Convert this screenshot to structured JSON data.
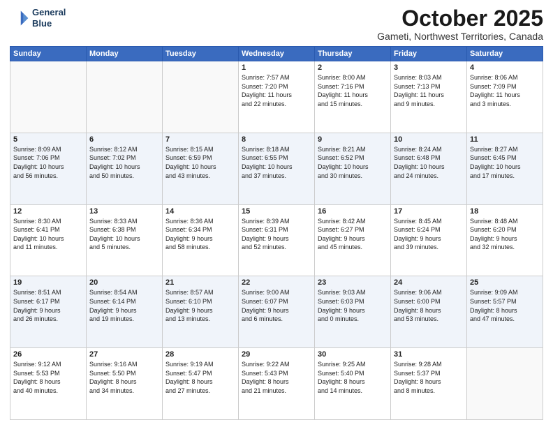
{
  "header": {
    "logo_line1": "General",
    "logo_line2": "Blue",
    "month_title": "October 2025",
    "location": "Gameti, Northwest Territories, Canada"
  },
  "weekdays": [
    "Sunday",
    "Monday",
    "Tuesday",
    "Wednesday",
    "Thursday",
    "Friday",
    "Saturday"
  ],
  "weeks": [
    [
      {
        "day": "",
        "text": ""
      },
      {
        "day": "",
        "text": ""
      },
      {
        "day": "",
        "text": ""
      },
      {
        "day": "1",
        "text": "Sunrise: 7:57 AM\nSunset: 7:20 PM\nDaylight: 11 hours\nand 22 minutes."
      },
      {
        "day": "2",
        "text": "Sunrise: 8:00 AM\nSunset: 7:16 PM\nDaylight: 11 hours\nand 15 minutes."
      },
      {
        "day": "3",
        "text": "Sunrise: 8:03 AM\nSunset: 7:13 PM\nDaylight: 11 hours\nand 9 minutes."
      },
      {
        "day": "4",
        "text": "Sunrise: 8:06 AM\nSunset: 7:09 PM\nDaylight: 11 hours\nand 3 minutes."
      }
    ],
    [
      {
        "day": "5",
        "text": "Sunrise: 8:09 AM\nSunset: 7:06 PM\nDaylight: 10 hours\nand 56 minutes."
      },
      {
        "day": "6",
        "text": "Sunrise: 8:12 AM\nSunset: 7:02 PM\nDaylight: 10 hours\nand 50 minutes."
      },
      {
        "day": "7",
        "text": "Sunrise: 8:15 AM\nSunset: 6:59 PM\nDaylight: 10 hours\nand 43 minutes."
      },
      {
        "day": "8",
        "text": "Sunrise: 8:18 AM\nSunset: 6:55 PM\nDaylight: 10 hours\nand 37 minutes."
      },
      {
        "day": "9",
        "text": "Sunrise: 8:21 AM\nSunset: 6:52 PM\nDaylight: 10 hours\nand 30 minutes."
      },
      {
        "day": "10",
        "text": "Sunrise: 8:24 AM\nSunset: 6:48 PM\nDaylight: 10 hours\nand 24 minutes."
      },
      {
        "day": "11",
        "text": "Sunrise: 8:27 AM\nSunset: 6:45 PM\nDaylight: 10 hours\nand 17 minutes."
      }
    ],
    [
      {
        "day": "12",
        "text": "Sunrise: 8:30 AM\nSunset: 6:41 PM\nDaylight: 10 hours\nand 11 minutes."
      },
      {
        "day": "13",
        "text": "Sunrise: 8:33 AM\nSunset: 6:38 PM\nDaylight: 10 hours\nand 5 minutes."
      },
      {
        "day": "14",
        "text": "Sunrise: 8:36 AM\nSunset: 6:34 PM\nDaylight: 9 hours\nand 58 minutes."
      },
      {
        "day": "15",
        "text": "Sunrise: 8:39 AM\nSunset: 6:31 PM\nDaylight: 9 hours\nand 52 minutes."
      },
      {
        "day": "16",
        "text": "Sunrise: 8:42 AM\nSunset: 6:27 PM\nDaylight: 9 hours\nand 45 minutes."
      },
      {
        "day": "17",
        "text": "Sunrise: 8:45 AM\nSunset: 6:24 PM\nDaylight: 9 hours\nand 39 minutes."
      },
      {
        "day": "18",
        "text": "Sunrise: 8:48 AM\nSunset: 6:20 PM\nDaylight: 9 hours\nand 32 minutes."
      }
    ],
    [
      {
        "day": "19",
        "text": "Sunrise: 8:51 AM\nSunset: 6:17 PM\nDaylight: 9 hours\nand 26 minutes."
      },
      {
        "day": "20",
        "text": "Sunrise: 8:54 AM\nSunset: 6:14 PM\nDaylight: 9 hours\nand 19 minutes."
      },
      {
        "day": "21",
        "text": "Sunrise: 8:57 AM\nSunset: 6:10 PM\nDaylight: 9 hours\nand 13 minutes."
      },
      {
        "day": "22",
        "text": "Sunrise: 9:00 AM\nSunset: 6:07 PM\nDaylight: 9 hours\nand 6 minutes."
      },
      {
        "day": "23",
        "text": "Sunrise: 9:03 AM\nSunset: 6:03 PM\nDaylight: 9 hours\nand 0 minutes."
      },
      {
        "day": "24",
        "text": "Sunrise: 9:06 AM\nSunset: 6:00 PM\nDaylight: 8 hours\nand 53 minutes."
      },
      {
        "day": "25",
        "text": "Sunrise: 9:09 AM\nSunset: 5:57 PM\nDaylight: 8 hours\nand 47 minutes."
      }
    ],
    [
      {
        "day": "26",
        "text": "Sunrise: 9:12 AM\nSunset: 5:53 PM\nDaylight: 8 hours\nand 40 minutes."
      },
      {
        "day": "27",
        "text": "Sunrise: 9:16 AM\nSunset: 5:50 PM\nDaylight: 8 hours\nand 34 minutes."
      },
      {
        "day": "28",
        "text": "Sunrise: 9:19 AM\nSunset: 5:47 PM\nDaylight: 8 hours\nand 27 minutes."
      },
      {
        "day": "29",
        "text": "Sunrise: 9:22 AM\nSunset: 5:43 PM\nDaylight: 8 hours\nand 21 minutes."
      },
      {
        "day": "30",
        "text": "Sunrise: 9:25 AM\nSunset: 5:40 PM\nDaylight: 8 hours\nand 14 minutes."
      },
      {
        "day": "31",
        "text": "Sunrise: 9:28 AM\nSunset: 5:37 PM\nDaylight: 8 hours\nand 8 minutes."
      },
      {
        "day": "",
        "text": ""
      }
    ]
  ]
}
